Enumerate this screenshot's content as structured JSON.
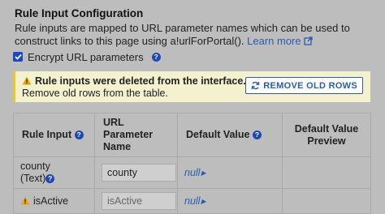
{
  "config": {
    "title": "Rule Input Configuration",
    "description": "Rule inputs are mapped to URL parameter names which can be used to construct links to this page using a!urlForPortal().",
    "learn_more": "Learn more",
    "encrypt_label": "Encrypt URL parameters",
    "encrypt_checked": true
  },
  "banner": {
    "bold_text": "Rule inputs were deleted from the interface.",
    "rest_text": "Remove old rows from the table.",
    "button_label": "REMOVE OLD ROWS"
  },
  "table": {
    "headers": [
      "Rule Input",
      "URL Parameter Name",
      "Default Value",
      "Default Value Preview"
    ],
    "rows": [
      {
        "rule_input": "county",
        "rule_type": "(Text)",
        "param": "county",
        "default_value": "null",
        "preview": ""
      },
      {
        "rule_input": "isActive",
        "param": "isActive",
        "default_value": "null",
        "preview": ""
      }
    ]
  },
  "colors": {
    "background": "#bdbdbd",
    "link": "#2a5db0",
    "checkbox": "#1f47b8",
    "banner_bg": "#f4f1cf",
    "banner_accent": "#e8c43a"
  }
}
